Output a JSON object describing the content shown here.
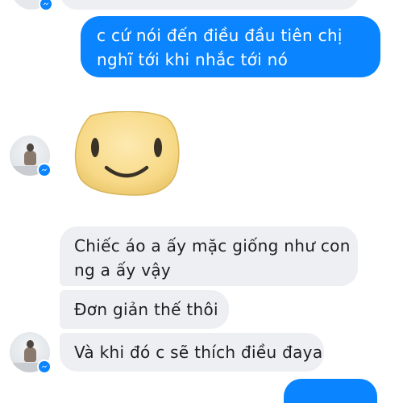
{
  "messages": {
    "outgoing_1": "c cứ nói đến điều đầu tiên chị\nnghĩ tới khi nhắc tới nó",
    "incoming_1": "Chiếc áo a ấy mặc giống như con\nng a ấy vậy",
    "incoming_2": "Đơn giản thế thôi",
    "incoming_3": "Và khi đó c sẽ thích điều đaya"
  },
  "sticker": {
    "icon": "smiley-sticker-icon"
  },
  "colors": {
    "outgoing_bubble": "#0a84ff",
    "incoming_bubble": "#eeeff2",
    "messenger_badge": "#0a84ff"
  }
}
